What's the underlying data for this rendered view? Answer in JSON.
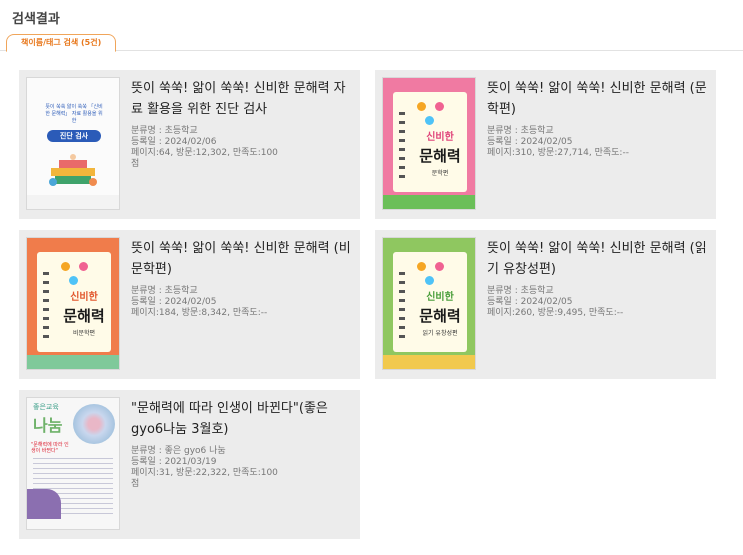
{
  "section_title": "검색결과",
  "tab_label": "책이름/태그 검색 (5건)",
  "results": [
    {
      "title": "뜻이 쑥쑥! 앎이 쑥쑥! 신비한 문해력 자료 활용을 위한 진단 검사",
      "category": "분류명 : 초등학교",
      "date": "등록일 : 2024/02/06",
      "stats": "페이지:64, 방문:12,302, 만족도:100점",
      "cover": {
        "title": "진단 검사",
        "text": "뜻이 쑥쑥 앎이 쑥쑥 「신비한 문해력」 자료 활용을 위한"
      }
    },
    {
      "title": "뜻이 쑥쑥! 앎이 쑥쑥! 신비한 문해력 (문학편)",
      "category": "분류명 : 초등학교",
      "date": "등록일 : 2024/02/05",
      "stats": "페이지:310, 방문:27,714, 만족도:--",
      "cover": {
        "small": "신비한",
        "big": "문해력",
        "sub": "문학편"
      }
    },
    {
      "title": "뜻이 쑥쑥! 앎이 쑥쑥! 신비한 문해력 (비문학편)",
      "category": "분류명 : 초등학교",
      "date": "등록일 : 2024/02/05",
      "stats": "페이지:184, 방문:8,342, 만족도:--",
      "cover": {
        "small": "신비한",
        "big": "문해력",
        "sub": "비문학편"
      }
    },
    {
      "title": "뜻이 쑥쑥! 앎이 쑥쑥! 신비한 문해력 (읽기 유창성편)",
      "category": "분류명 : 초등학교",
      "date": "등록일 : 2024/02/05",
      "stats": "페이지:260, 방문:9,495, 만족도:--",
      "cover": {
        "small": "신비한",
        "big": "문해력",
        "sub": "읽기 유창성편"
      }
    },
    {
      "title": "\"문해력에 따라 인생이 바뀐다\"(좋은 gyo6나눔 3월호)",
      "category": "분류명 : 좋은 gyo6 나눔",
      "date": "등록일 : 2021/03/19",
      "stats": "페이지:31, 방문:22,322, 만족도:100점",
      "cover": {
        "logo": "좋은교육",
        "big": "나눔",
        "headline": "\"문해력에 따라 인생이 바뀐다\""
      }
    }
  ],
  "colors": {
    "accent": "#e8791e",
    "card_bg": "#ececec"
  }
}
